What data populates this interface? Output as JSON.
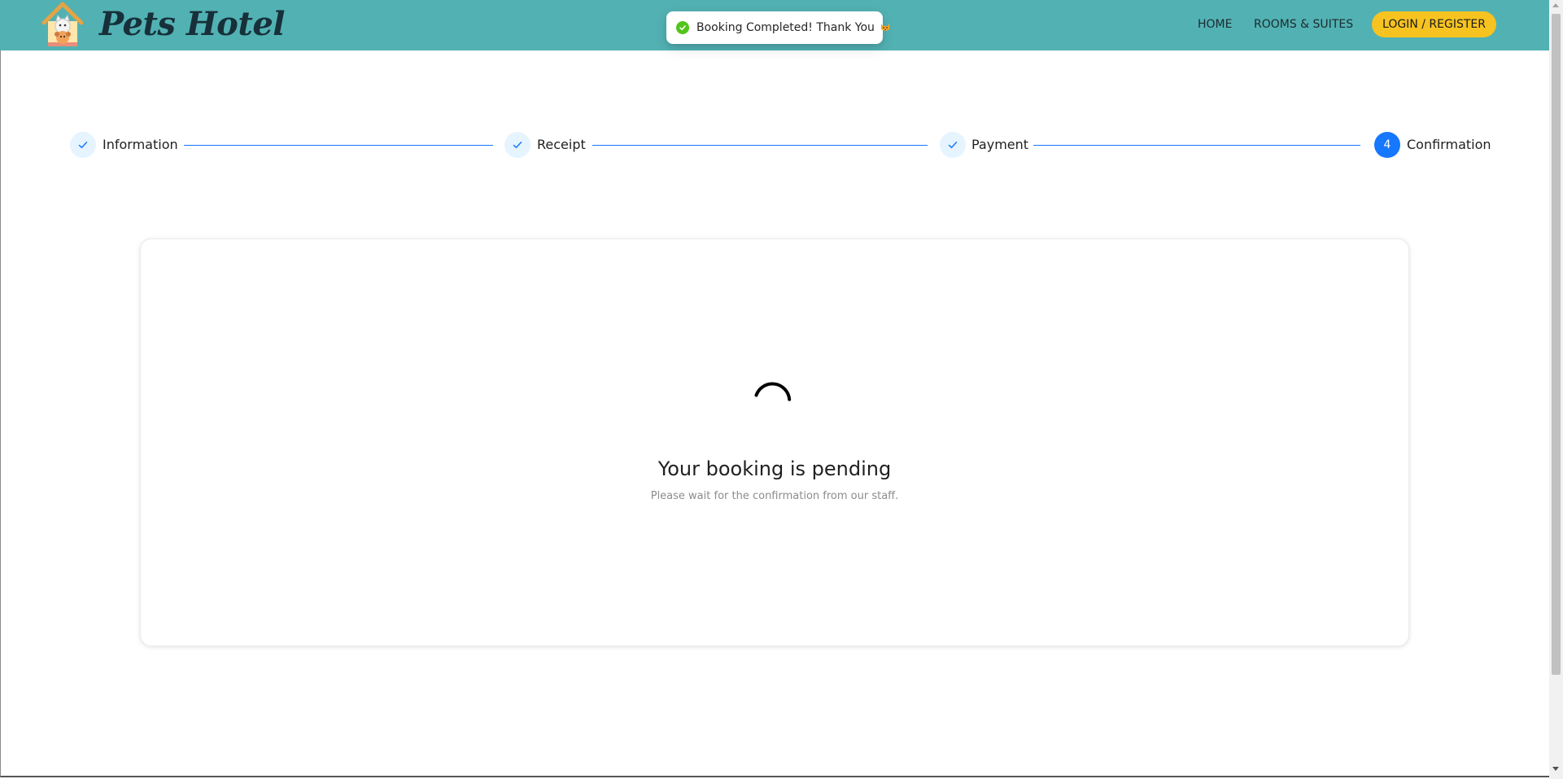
{
  "header": {
    "brand": "Pets Hotel",
    "logo_icon": "pet-house-logo",
    "nav": {
      "home": "HOME",
      "rooms": "ROOMS & SUITES"
    },
    "login_label": "LOGIN / REGISTER",
    "background_color": "#52b1b3",
    "login_color": "#f7c320"
  },
  "toast": {
    "icon": "check-circle-icon",
    "message": "Booking Completed! Thank You",
    "emoji_icon": "cat-face-icon",
    "icon_color": "#52c41a"
  },
  "steps": {
    "items": [
      {
        "label": "Information",
        "status": "done",
        "icon": "check-icon"
      },
      {
        "label": "Receipt",
        "status": "done",
        "icon": "check-icon"
      },
      {
        "label": "Payment",
        "status": "done",
        "icon": "check-icon"
      },
      {
        "label": "Confirmation",
        "status": "active",
        "number": "4"
      }
    ],
    "accent_color": "#1677ff"
  },
  "result": {
    "spinner_icon": "loading-spinner-icon",
    "title": "Your booking is pending",
    "subtitle": "Please wait for the confirmation from our staff."
  }
}
